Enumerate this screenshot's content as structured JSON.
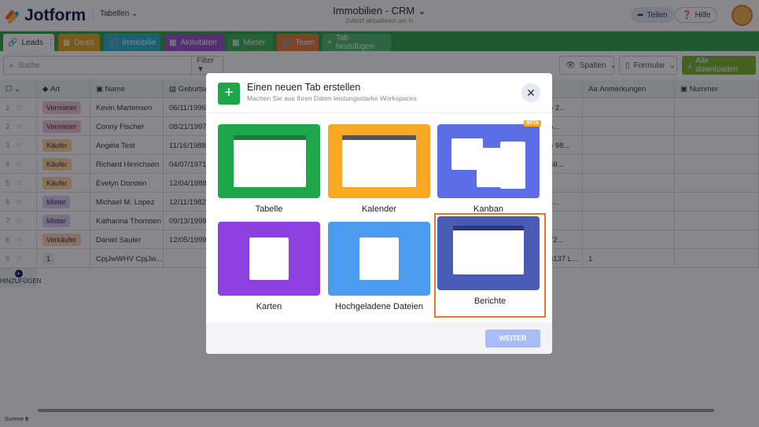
{
  "header": {
    "logo": "Jotform",
    "tables_menu": "Tabellen",
    "title": "Immobilien - CRM",
    "subtitle": "Zuletzt aktualisiert am",
    "share": "Teilen",
    "help": "Hilfe"
  },
  "tabs": [
    {
      "label": "Leads",
      "color": "#ffffff"
    },
    {
      "label": "Deals",
      "color": "#e8a317"
    },
    {
      "label": "Immobilie",
      "color": "#28b0c9"
    },
    {
      "label": "Aktivitäten",
      "color": "#9b4fc8"
    },
    {
      "label": "Mieter",
      "color": "#3cb04f"
    },
    {
      "label": "Team",
      "color": "#e8772e"
    },
    {
      "label": "Tab hinzufügen",
      "color": "#4fb86a"
    }
  ],
  "toolbar": {
    "search_placeholder": "Suche",
    "filter": "Filter",
    "columns": "Spalten",
    "form": "Formular",
    "download": "Alle downloaden"
  },
  "columns": [
    "Art",
    "Name",
    "Geburtsdatum",
    "Anmerkungen",
    "Nummer"
  ],
  "rows": [
    {
      "n": "1",
      "art": "Vermieter",
      "name": "Kevin Martensen",
      "date": "06/11/1996",
      "addr": "e 2..."
    },
    {
      "n": "2",
      "art": "Vermieter",
      "name": "Conny Fischer",
      "date": "08/21/1997",
      "addr": "5..."
    },
    {
      "n": "3",
      "art": "Käufer",
      "name": "Angela Test",
      "date": "11/16/1988",
      "addr": "e 98..."
    },
    {
      "n": "4",
      "art": "Käufer",
      "name": "Richard Hinrichsen",
      "date": "04/07/1971",
      "addr": "59..."
    },
    {
      "n": "5",
      "art": "Käufer",
      "name": "Evelyn Dorsten",
      "date": "12/04/1988",
      "addr": ""
    },
    {
      "n": "6",
      "art": "Mieter",
      "name": "Michael M. Lopez",
      "date": "12/11/1982",
      "addr": "4..."
    },
    {
      "n": "7",
      "art": "Mieter",
      "name": "Katharina Thomsen",
      "date": "09/13/1999",
      "addr": "."
    },
    {
      "n": "8",
      "art": "Verkäufer",
      "name": "Daniel Sauter",
      "date": "12/05/1999",
      "addr": "72..."
    },
    {
      "n": "9",
      "art": "1",
      "name": "CpjJwWHV CpjJw...",
      "date": "",
      "addr": "3137 L...",
      "note": "1"
    }
  ],
  "add_row": "HINZUFÜGEN",
  "footer": {
    "sum_label": "Summe",
    "sum_value": "9"
  },
  "modal": {
    "title": "Einen neuen Tab erstellen",
    "subtitle": "Machen Sie aus Ihren Daten leistungsstarke Workspaces",
    "badge": "BETA",
    "next": "WEITER",
    "options": [
      "Tabelle",
      "Kalender",
      "Kanban",
      "Karten",
      "Hochgeladene Dateien",
      "Berichte"
    ],
    "selected": "Berichte"
  }
}
